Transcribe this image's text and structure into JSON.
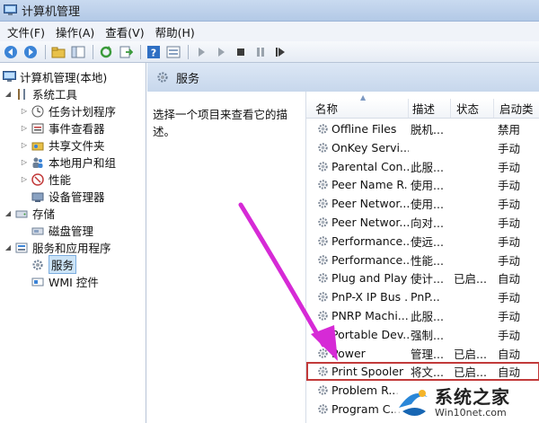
{
  "window": {
    "title": "计算机管理"
  },
  "menu": [
    {
      "label": "文件(F)"
    },
    {
      "label": "操作(A)"
    },
    {
      "label": "查看(V)"
    },
    {
      "label": "帮助(H)"
    }
  ],
  "toolbar": {
    "buttons": [
      "back-icon",
      "forward-icon",
      "up-folder-icon",
      "show-hide-tree-icon",
      "refresh-icon",
      "export-icon",
      "help-icon",
      "properties-icon",
      "play-icon",
      "play-icon-2",
      "stop-icon",
      "pause-icon",
      "restart-icon"
    ]
  },
  "tree": {
    "root": "计算机管理(本地)",
    "system_tools": "系统工具",
    "task_scheduler": "任务计划程序",
    "event_viewer": "事件查看器",
    "shared_folders": "共享文件夹",
    "local_users": "本地用户和组",
    "performance": "性能",
    "device_manager": "设备管理器",
    "storage": "存储",
    "disk_management": "磁盘管理",
    "services_apps": "服务和应用程序",
    "services": "服务",
    "wmi": "WMI 控件"
  },
  "right": {
    "header": "服务",
    "description": "选择一个项目来查看它的描述。"
  },
  "columns": {
    "name": "名称",
    "desc": "描述",
    "status": "状态",
    "startup": "启动类"
  },
  "services": [
    {
      "name": "Offline Files",
      "desc": "脱机...",
      "status": "",
      "startup": "禁用"
    },
    {
      "name": "OnKey Servi...",
      "desc": "",
      "status": "",
      "startup": "手动"
    },
    {
      "name": "Parental Con...",
      "desc": "此服...",
      "status": "",
      "startup": "手动"
    },
    {
      "name": "Peer Name R...",
      "desc": "使用...",
      "status": "",
      "startup": "手动"
    },
    {
      "name": "Peer Networ...",
      "desc": "使用...",
      "status": "",
      "startup": "手动"
    },
    {
      "name": "Peer Networ...",
      "desc": "向对...",
      "status": "",
      "startup": "手动"
    },
    {
      "name": "Performance...",
      "desc": "使远...",
      "status": "",
      "startup": "手动"
    },
    {
      "name": "Performance...",
      "desc": "性能...",
      "status": "",
      "startup": "手动"
    },
    {
      "name": "Plug and Play",
      "desc": "使计...",
      "status": "已启...",
      "startup": "自动"
    },
    {
      "name": "PnP-X IP Bus ...",
      "desc": "PnP...",
      "status": "",
      "startup": "手动"
    },
    {
      "name": "PNRP Machi...",
      "desc": "此服...",
      "status": "",
      "startup": "手动"
    },
    {
      "name": "Portable Dev...",
      "desc": "强制...",
      "status": "",
      "startup": "手动"
    },
    {
      "name": "Power",
      "desc": "管理...",
      "status": "已启...",
      "startup": "自动"
    },
    {
      "name": "Print Spooler",
      "desc": "将文...",
      "status": "已启...",
      "startup": "自动"
    },
    {
      "name": "Problem R...",
      "desc": "",
      "status": "",
      "startup": ""
    },
    {
      "name": "Program C...",
      "desc": "",
      "status": "",
      "startup": ""
    }
  ],
  "watermark": {
    "title": "系统之家",
    "url": "Win10net.com"
  },
  "colors": {
    "highlight_border": "#c23a3a",
    "annotation_arrow": "#d62ad6",
    "selection": "#cce4f7"
  }
}
